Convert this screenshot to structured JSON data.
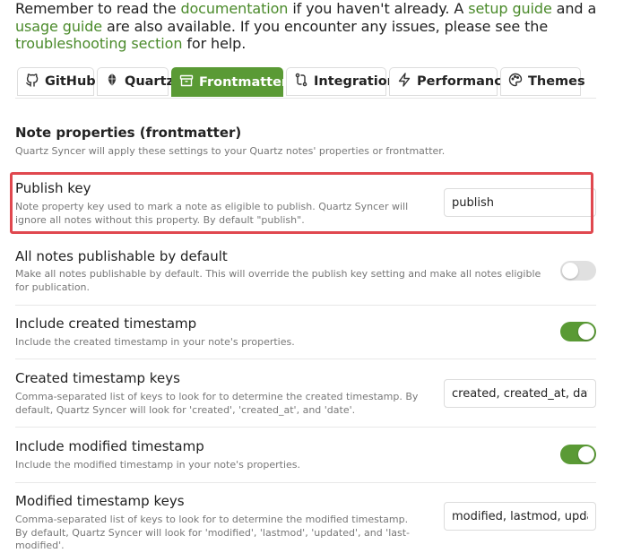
{
  "intro": {
    "t1": "Remember to read the ",
    "doc_link": "documentation",
    "t2": " if you haven't already. A ",
    "setup_link": "setup guide",
    "t3": " and a ",
    "usage_link": "usage guide",
    "t4": " are also available. If you encounter any issues, please see the ",
    "trouble_link": "troubleshooting section",
    "t5": " for help."
  },
  "tabs": [
    {
      "label": "GitHub",
      "icon": "github-icon",
      "active": false
    },
    {
      "label": "Quartz",
      "icon": "quartz-icon",
      "active": false
    },
    {
      "label": "Frontmatter",
      "icon": "archive-icon",
      "active": true
    },
    {
      "label": "Integration",
      "icon": "integration-icon",
      "active": false
    },
    {
      "label": "Performance",
      "icon": "zap-icon",
      "active": false
    },
    {
      "label": "Themes",
      "icon": "palette-icon",
      "active": false
    }
  ],
  "section": {
    "title": "Note properties (frontmatter)",
    "desc": "Quartz Syncer will apply these settings to your Quartz notes' properties or frontmatter."
  },
  "settings": {
    "publish_key": {
      "name": "Publish key",
      "desc": "Note property key used to mark a note as eligible to publish. Quartz Syncer will ignore all notes without this property. By default \"publish\".",
      "value": "publish"
    },
    "all_publishable": {
      "name": "All notes publishable by default",
      "desc": "Make all notes publishable by default. This will override the publish key setting and make all notes eligible for publication.",
      "enabled": false
    },
    "include_created": {
      "name": "Include created timestamp",
      "desc": "Include the created timestamp in your note's properties.",
      "enabled": true
    },
    "created_keys": {
      "name": "Created timestamp keys",
      "desc": "Comma-separated list of keys to look for to determine the created timestamp. By default, Quartz Syncer will look for 'created', 'created_at', and 'date'.",
      "value": "created, created_at, date"
    },
    "include_modified": {
      "name": "Include modified timestamp",
      "desc": "Include the modified timestamp in your note's properties.",
      "enabled": true
    },
    "modified_keys": {
      "name": "Modified timestamp keys",
      "desc": "Comma-separated list of keys to look for to determine the modified timestamp. By default, Quartz Syncer will look for 'modified', 'lastmod', 'updated', and 'last-modified'.",
      "value": "modified, lastmod, updated, last-modified"
    }
  },
  "colors": {
    "accent": "#5a9a35",
    "link": "#4a8a2a",
    "highlight_border": "#e0484f"
  }
}
